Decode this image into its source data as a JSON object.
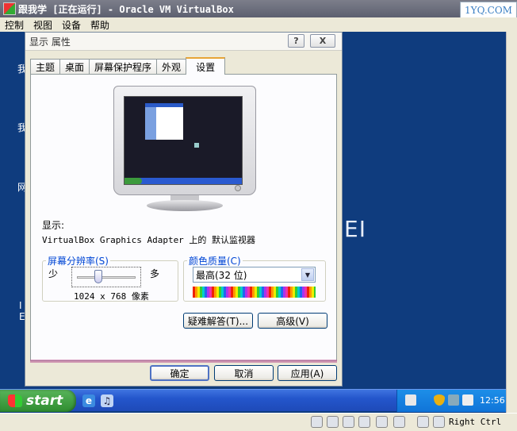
{
  "host": {
    "title": "跟我学 [正在运行] - Oracle VM VirtualBox",
    "watermark": "1YQ.COM",
    "menu": [
      "控制",
      "视图",
      "设备",
      "帮助"
    ],
    "host_key": "Right Ctrl"
  },
  "desktop": {
    "partial_text": "EI",
    "side_glyphs": [
      "我",
      "我",
      "网",
      "I",
      "E"
    ]
  },
  "dialog": {
    "title": "显示 属性",
    "help_label": "?",
    "close_label": "X",
    "tabs": [
      "主题",
      "桌面",
      "屏幕保护程序",
      "外观",
      "设置"
    ],
    "active_tab": "设置",
    "display_label": "显示:",
    "display_device": "VirtualBox Graphics Adapter 上的 默认监视器",
    "resolution": {
      "legend": "屏幕分辨率(S)",
      "less": "少",
      "more": "多",
      "value": "1024 x 768 像素",
      "slider_position": 0.35
    },
    "color_quality": {
      "legend": "颜色质量(C)",
      "selected": "最高(32 位)"
    },
    "troubleshoot_label": "疑难解答(T)...",
    "advanced_label": "高级(V)",
    "ok_label": "确定",
    "cancel_label": "取消",
    "apply_label": "应用(A)"
  },
  "taskbar": {
    "start_label": "start",
    "clock": "12:56"
  }
}
